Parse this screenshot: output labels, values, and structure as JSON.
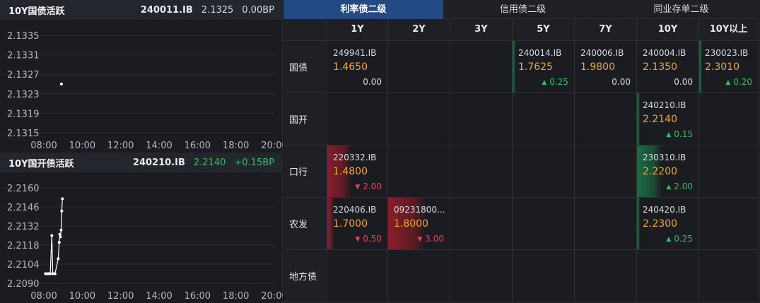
{
  "colors": {
    "up": "#2fbf6a",
    "down": "#f0404e",
    "accent_tab": "#244a86",
    "yield": "#f0a631"
  },
  "charts": [
    {
      "title": "10Y国债活跃",
      "code": "240011.IB",
      "yield": "2.1325",
      "bp": "0.00BP",
      "bp_color": "#d8dbe0",
      "chart_data": {
        "type": "scatter",
        "title": "10Y国债活跃",
        "x_ticks": [
          "08:00",
          "10:00",
          "12:00",
          "14:00",
          "16:00",
          "18:00",
          "20:00"
        ],
        "y_ticks": [
          "2.1335",
          "2.1331",
          "2.1327",
          "2.1323",
          "2.1319",
          "2.1315"
        ],
        "xlim": [
          "08:00",
          "20:00"
        ],
        "ylim": [
          2.1315,
          2.1335
        ],
        "series": [
          {
            "points": [
              {
                "x": "08:55",
                "y": 2.1325
              }
            ]
          }
        ]
      }
    },
    {
      "title": "10Y国开债活跃",
      "code": "240210.IB",
      "yield": "2.2140",
      "bp": "+0.15BP",
      "bp_color": "#2fbf6a",
      "chart_data": {
        "type": "line",
        "title": "10Y国开债活跃",
        "x_ticks": [
          "08:00",
          "10:00",
          "12:00",
          "14:00",
          "16:00",
          "18:00",
          "20:00"
        ],
        "y_ticks": [
          "2.2160",
          "2.2146",
          "2.2132",
          "2.2118",
          "2.2104",
          "2.2090"
        ],
        "xlim": [
          "08:00",
          "20:00"
        ],
        "ylim": [
          2.209,
          2.216
        ],
        "series": [
          {
            "points": [
              {
                "x": "08:05",
                "y": 2.2097
              },
              {
                "x": "08:10",
                "y": 2.2097
              },
              {
                "x": "08:15",
                "y": 2.2097
              },
              {
                "x": "08:20",
                "y": 2.2097
              },
              {
                "x": "08:25",
                "y": 2.2125
              },
              {
                "x": "08:28",
                "y": 2.2097
              },
              {
                "x": "08:35",
                "y": 2.2097
              },
              {
                "x": "08:45",
                "y": 2.2108
              },
              {
                "x": "08:48",
                "y": 2.212
              },
              {
                "x": "08:50",
                "y": 2.2126
              },
              {
                "x": "08:52",
                "y": 2.2124
              },
              {
                "x": "08:54",
                "y": 2.2129
              },
              {
                "x": "08:56",
                "y": 2.2143
              },
              {
                "x": "08:58",
                "y": 2.2152
              }
            ]
          }
        ]
      }
    }
  ],
  "tabs": [
    {
      "label": "利率债二级",
      "active": true
    },
    {
      "label": "信用债二级",
      "active": false
    },
    {
      "label": "同业存单二级",
      "active": false
    }
  ],
  "columns": [
    "1Y",
    "2Y",
    "3Y",
    "5Y",
    "7Y",
    "10Y",
    "10Y以上"
  ],
  "rows": [
    {
      "label": "国债",
      "cells": [
        {
          "code": "249941.IB",
          "yield": "1.4650",
          "chg": "0.00",
          "dir": "flat",
          "bar": 0
        },
        null,
        null,
        {
          "code": "240014.IB",
          "yield": "1.7625",
          "chg": "0.25",
          "dir": "up",
          "bar": 0.04
        },
        {
          "code": "240006.IB",
          "yield": "1.9800",
          "chg": "0.00",
          "dir": "flat",
          "bar": 0
        },
        {
          "code": "240004.IB",
          "yield": "2.1350",
          "chg": "0.00",
          "dir": "flat",
          "bar": 0
        },
        {
          "code": "230023.IB",
          "yield": "2.3010",
          "chg": "0.20",
          "dir": "up",
          "bar": 0.04
        }
      ]
    },
    {
      "label": "国开",
      "cells": [
        null,
        null,
        null,
        null,
        null,
        {
          "code": "240210.IB",
          "yield": "2.2140",
          "chg": "0.15",
          "dir": "up",
          "bar": 0.04
        },
        null
      ]
    },
    {
      "label": "口行",
      "cells": [
        {
          "code": "220332.IB",
          "yield": "1.4800",
          "chg": "2.00",
          "dir": "down",
          "bar": 0.4
        },
        null,
        null,
        null,
        null,
        {
          "code": "230310.IB",
          "yield": "2.2200",
          "chg": "2.00",
          "dir": "up",
          "bar": 0.4
        },
        null
      ]
    },
    {
      "label": "农发",
      "cells": [
        {
          "code": "220406.IB",
          "yield": "1.7000",
          "chg": "0.50",
          "dir": "down",
          "bar": 0.1
        },
        {
          "code": "09231800...",
          "yield": "1.8000",
          "chg": "3.00",
          "dir": "down",
          "bar": 0.6
        },
        null,
        null,
        null,
        {
          "code": "240420.IB",
          "yield": "2.2300",
          "chg": "0.25",
          "dir": "up",
          "bar": 0.05
        },
        null
      ]
    },
    {
      "label": "地方债",
      "cells": [
        null,
        null,
        null,
        null,
        null,
        null,
        null
      ]
    }
  ]
}
